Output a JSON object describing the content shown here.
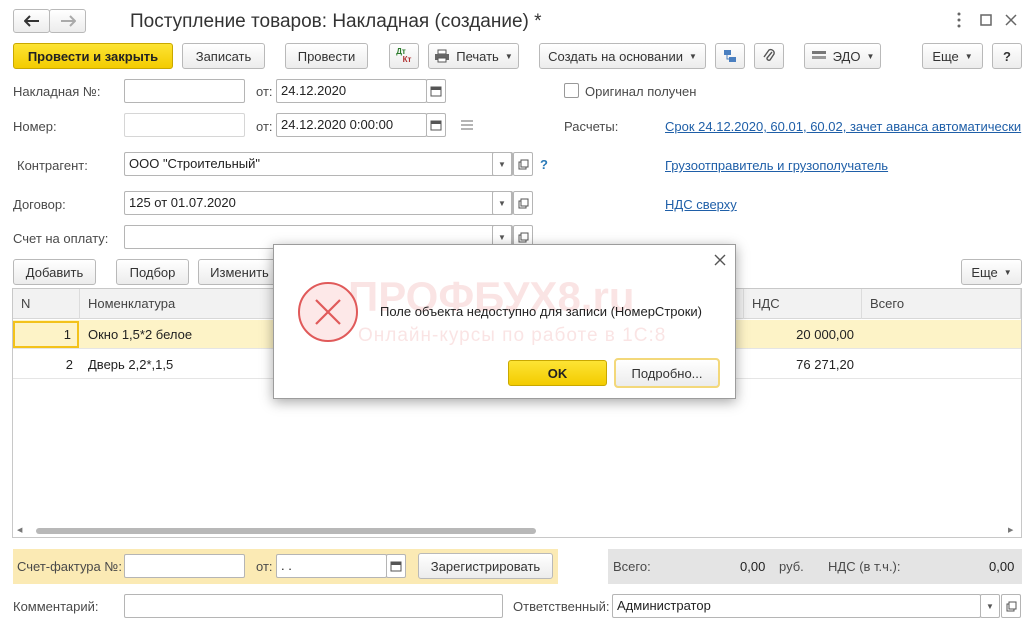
{
  "window": {
    "title": "Поступление товаров: Накладная (создание) *",
    "menu_icon": "more-vertical-icon",
    "maximize_icon": "maximize-icon",
    "close_icon": "close-icon"
  },
  "toolbar": {
    "post_close": "Провести и закрыть",
    "save": "Записать",
    "post": "Провести",
    "dtkt_top": "Дт",
    "dtkt_bottom": "Кт",
    "print": "Печать",
    "create_based": "Создать на основании",
    "edo": "ЭДО",
    "more": "Еще",
    "help": "?"
  },
  "form": {
    "invoice_no_label": "Накладная №:",
    "invoice_no_value": "",
    "from_label": "от:",
    "invoice_date": "24.12.2020",
    "original_received": "Оригинал получен",
    "number_label": "Номер:",
    "number_value": "",
    "number_datetime": "24.12.2020  0:00:00",
    "settlements_label": "Расчеты:",
    "settlements_link": "Срок 24.12.2020, 60.01, 60.02, зачет аванса автоматически",
    "counterparty_label": "Контрагент:",
    "counterparty_value": "ООО \"Строительный\"",
    "help_mark": "?",
    "shipper_link": "Грузоотправитель и грузополучатель",
    "contract_label": "Договор:",
    "contract_value": "125 от 01.07.2020",
    "vat_link": "НДС сверху",
    "payment_invoice_label": "Счет на оплату:",
    "payment_invoice_value": ""
  },
  "table_toolbar": {
    "add": "Добавить",
    "pick": "Подбор",
    "change": "Изменить",
    "more": "Еще"
  },
  "table": {
    "headers": [
      "N",
      "Номенклатура",
      "НДС",
      "Всего"
    ],
    "rows": [
      {
        "n": "1",
        "name": "Окно 1,5*2 белое",
        "vat": "20 000,00",
        "total": ""
      },
      {
        "n": "2",
        "name": "Дверь 2,2*,1,5",
        "vat": "76 271,20",
        "total": ""
      }
    ]
  },
  "footer": {
    "invoice_label": "Счет-фактура №:",
    "invoice_value": "",
    "from_label": "от:",
    "invoice_date": " .  .",
    "register": "Зарегистрировать",
    "total_label": "Всего:",
    "total_value": "0,00",
    "currency": "руб.",
    "vat_label": "НДС (в т.ч.):",
    "vat_value": "0,00",
    "comment_label": "Комментарий:",
    "comment_value": "",
    "responsible_label": "Ответственный:",
    "responsible_value": "Администратор"
  },
  "dialog": {
    "message": "Поле объекта недоступно для записи (НомерСтроки)",
    "ok": "OK",
    "details": "Подробно...",
    "close_icon": "close-icon",
    "error_icon": "error-icon"
  },
  "watermark": {
    "brand": "ПРОФБУХ8.ru",
    "tagline": "Онлайн-курсы по работе в 1С:8"
  },
  "colors": {
    "accent_yellow": "#f7d51d",
    "link_blue": "#1f5fa8",
    "row_selected": "#fdf3c7",
    "error_red": "#e05a5a"
  }
}
